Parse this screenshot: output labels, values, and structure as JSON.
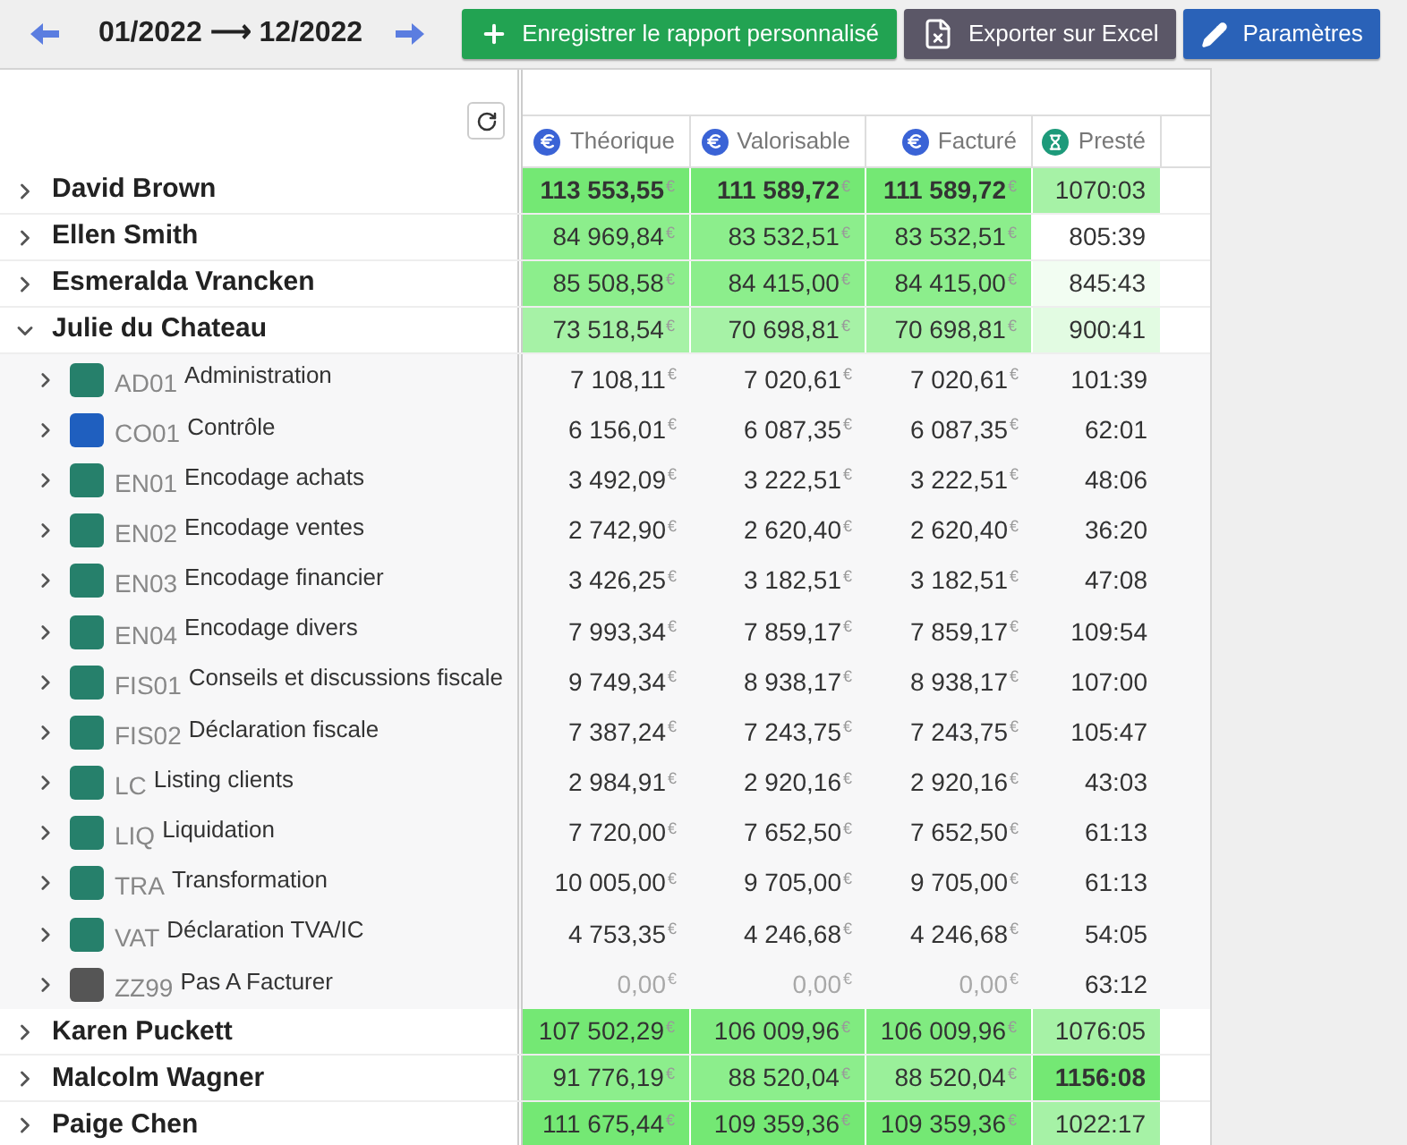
{
  "toolbar": {
    "period": "01/2022 ⟶ 12/2022",
    "buttons": [
      {
        "kind": "save",
        "label": "Enregistrer le rapport personnalisé"
      },
      {
        "kind": "excel",
        "label": "Exporter sur Excel"
      },
      {
        "kind": "settings",
        "label": "Paramètres"
      }
    ]
  },
  "table": {
    "columns": [
      {
        "kind": "money",
        "label": "Théorique"
      },
      {
        "kind": "money",
        "label": "Valorisable"
      },
      {
        "kind": "money",
        "label": "Facturé"
      },
      {
        "kind": "time",
        "label": "Presté"
      }
    ],
    "rows": [
      {
        "name": "David Brown",
        "expanded": false,
        "cells": [
          {
            "value": "113 553,55",
            "unit": "€",
            "color": "#74e874",
            "bold": true
          },
          {
            "value": "111 589,72",
            "unit": "€",
            "color": "#74e874",
            "bold": true
          },
          {
            "value": "111 589,72",
            "unit": "€",
            "color": "#74e874",
            "bold": true
          },
          {
            "value": "1070:03",
            "color": "#a6f2a6",
            "bold": false
          }
        ]
      },
      {
        "name": "Ellen Smith",
        "expanded": false,
        "cells": [
          {
            "value": "84 969,84",
            "unit": "€",
            "color": "#8cee8c",
            "bold": false
          },
          {
            "value": "83 532,51",
            "unit": "€",
            "color": "#8cee8c",
            "bold": false
          },
          {
            "value": "83 532,51",
            "unit": "€",
            "color": "#8cee8c",
            "bold": false
          },
          {
            "value": "805:39",
            "color": "#ffffff",
            "bold": false
          }
        ]
      },
      {
        "name": "Esmeralda Vrancken",
        "expanded": false,
        "cells": [
          {
            "value": "85 508,58",
            "unit": "€",
            "color": "#8cee8c",
            "bold": false
          },
          {
            "value": "84 415,00",
            "unit": "€",
            "color": "#8cee8c",
            "bold": false
          },
          {
            "value": "84 415,00",
            "unit": "€",
            "color": "#8cee8c",
            "bold": false
          },
          {
            "value": "845:43",
            "color": "#f2fdf2",
            "bold": false
          }
        ]
      },
      {
        "name": "Julie du Chateau",
        "expanded": true,
        "cells": [
          {
            "value": "73 518,54",
            "unit": "€",
            "color": "#a6f2a6",
            "bold": false
          },
          {
            "value": "70 698,81",
            "unit": "€",
            "color": "#a6f2a6",
            "bold": false
          },
          {
            "value": "70 698,81",
            "unit": "€",
            "color": "#a6f2a6",
            "bold": false
          },
          {
            "value": "900:41",
            "color": "#e2fbe2",
            "bold": false
          }
        ],
        "children": [
          {
            "code": "AD01",
            "name": "Administration",
            "color": "#26806b",
            "expanded": false,
            "cells": [
              {
                "value": "7 108,11",
                "unit": "€",
                "muted": false
              },
              {
                "value": "7 020,61",
                "unit": "€",
                "muted": false
              },
              {
                "value": "7 020,61",
                "unit": "€",
                "muted": false
              },
              {
                "value": "101:39",
                "muted": false
              }
            ]
          },
          {
            "code": "CO01",
            "name": "Contrôle",
            "color": "#1f5fbf",
            "expanded": false,
            "cells": [
              {
                "value": "6 156,01",
                "unit": "€",
                "muted": false
              },
              {
                "value": "6 087,35",
                "unit": "€",
                "muted": false
              },
              {
                "value": "6 087,35",
                "unit": "€",
                "muted": false
              },
              {
                "value": "62:01",
                "muted": false
              }
            ]
          },
          {
            "code": "EN01",
            "name": "Encodage achats",
            "color": "#26806b",
            "expanded": false,
            "cells": [
              {
                "value": "3 492,09",
                "unit": "€",
                "muted": false
              },
              {
                "value": "3 222,51",
                "unit": "€",
                "muted": false
              },
              {
                "value": "3 222,51",
                "unit": "€",
                "muted": false
              },
              {
                "value": "48:06",
                "muted": false
              }
            ]
          },
          {
            "code": "EN02",
            "name": "Encodage ventes",
            "color": "#26806b",
            "expanded": false,
            "cells": [
              {
                "value": "2 742,90",
                "unit": "€",
                "muted": false
              },
              {
                "value": "2 620,40",
                "unit": "€",
                "muted": false
              },
              {
                "value": "2 620,40",
                "unit": "€",
                "muted": false
              },
              {
                "value": "36:20",
                "muted": false
              }
            ]
          },
          {
            "code": "EN03",
            "name": "Encodage financier",
            "color": "#26806b",
            "expanded": false,
            "cells": [
              {
                "value": "3 426,25",
                "unit": "€",
                "muted": false
              },
              {
                "value": "3 182,51",
                "unit": "€",
                "muted": false
              },
              {
                "value": "3 182,51",
                "unit": "€",
                "muted": false
              },
              {
                "value": "47:08",
                "muted": false
              }
            ]
          },
          {
            "code": "EN04",
            "name": "Encodage divers",
            "color": "#26806b",
            "expanded": false,
            "cells": [
              {
                "value": "7 993,34",
                "unit": "€",
                "muted": false
              },
              {
                "value": "7 859,17",
                "unit": "€",
                "muted": false
              },
              {
                "value": "7 859,17",
                "unit": "€",
                "muted": false
              },
              {
                "value": "109:54",
                "muted": false
              }
            ]
          },
          {
            "code": "FIS01",
            "name": "Conseils et discussions fiscale",
            "color": "#26806b",
            "expanded": false,
            "cells": [
              {
                "value": "9 749,34",
                "unit": "€",
                "muted": false
              },
              {
                "value": "8 938,17",
                "unit": "€",
                "muted": false
              },
              {
                "value": "8 938,17",
                "unit": "€",
                "muted": false
              },
              {
                "value": "107:00",
                "muted": false
              }
            ]
          },
          {
            "code": "FIS02",
            "name": "Déclaration fiscale",
            "color": "#26806b",
            "expanded": false,
            "cells": [
              {
                "value": "7 387,24",
                "unit": "€",
                "muted": false
              },
              {
                "value": "7 243,75",
                "unit": "€",
                "muted": false
              },
              {
                "value": "7 243,75",
                "unit": "€",
                "muted": false
              },
              {
                "value": "105:47",
                "muted": false
              }
            ]
          },
          {
            "code": "LC",
            "name": "Listing clients",
            "color": "#26806b",
            "expanded": false,
            "cells": [
              {
                "value": "2 984,91",
                "unit": "€",
                "muted": false
              },
              {
                "value": "2 920,16",
                "unit": "€",
                "muted": false
              },
              {
                "value": "2 920,16",
                "unit": "€",
                "muted": false
              },
              {
                "value": "43:03",
                "muted": false
              }
            ]
          },
          {
            "code": "LIQ",
            "name": "Liquidation",
            "color": "#26806b",
            "expanded": false,
            "cells": [
              {
                "value": "7 720,00",
                "unit": "€",
                "muted": false
              },
              {
                "value": "7 652,50",
                "unit": "€",
                "muted": false
              },
              {
                "value": "7 652,50",
                "unit": "€",
                "muted": false
              },
              {
                "value": "61:13",
                "muted": false
              }
            ]
          },
          {
            "code": "TRA",
            "name": "Transformation",
            "color": "#26806b",
            "expanded": false,
            "cells": [
              {
                "value": "10 005,00",
                "unit": "€",
                "muted": false
              },
              {
                "value": "9 705,00",
                "unit": "€",
                "muted": false
              },
              {
                "value": "9 705,00",
                "unit": "€",
                "muted": false
              },
              {
                "value": "61:13",
                "muted": false
              }
            ]
          },
          {
            "code": "VAT",
            "name": "Déclaration TVA/IC",
            "color": "#26806b",
            "expanded": false,
            "cells": [
              {
                "value": "4 753,35",
                "unit": "€",
                "muted": false
              },
              {
                "value": "4 246,68",
                "unit": "€",
                "muted": false
              },
              {
                "value": "4 246,68",
                "unit": "€",
                "muted": false
              },
              {
                "value": "54:05",
                "muted": false
              }
            ]
          },
          {
            "code": "ZZ99",
            "name": "Pas A Facturer",
            "color": "#555555",
            "expanded": false,
            "cells": [
              {
                "value": "0,00",
                "unit": "€",
                "muted": true
              },
              {
                "value": "0,00",
                "unit": "€",
                "muted": true
              },
              {
                "value": "0,00",
                "unit": "€",
                "muted": true
              },
              {
                "value": "63:12",
                "muted": false
              }
            ]
          }
        ]
      },
      {
        "name": "Karen Puckett",
        "expanded": false,
        "cells": [
          {
            "value": "107 502,29",
            "unit": "€",
            "color": "#74e874",
            "bold": false
          },
          {
            "value": "106 009,96",
            "unit": "€",
            "color": "#80eb80",
            "bold": false
          },
          {
            "value": "106 009,96",
            "unit": "€",
            "color": "#80eb80",
            "bold": false
          },
          {
            "value": "1076:05",
            "color": "#a6f2a6",
            "bold": false
          }
        ]
      },
      {
        "name": "Malcolm Wagner",
        "expanded": false,
        "cells": [
          {
            "value": "91 776,19",
            "unit": "€",
            "color": "#8cee8c",
            "bold": false
          },
          {
            "value": "88 520,04",
            "unit": "€",
            "color": "#8cee8c",
            "bold": false
          },
          {
            "value": "88 520,04",
            "unit": "€",
            "color": "#9af09a",
            "bold": false
          },
          {
            "value": "1156:08",
            "color": "#74e874",
            "bold": true
          }
        ]
      },
      {
        "name": "Paige Chen",
        "expanded": false,
        "cells": [
          {
            "value": "111 675,44",
            "unit": "€",
            "color": "#74e874",
            "bold": false
          },
          {
            "value": "109 359,36",
            "unit": "€",
            "color": "#74e874",
            "bold": false
          },
          {
            "value": "109 359,36",
            "unit": "€",
            "color": "#74e874",
            "bold": false
          },
          {
            "value": "1022:17",
            "color": "#a6f2a6",
            "bold": false
          }
        ]
      }
    ]
  }
}
